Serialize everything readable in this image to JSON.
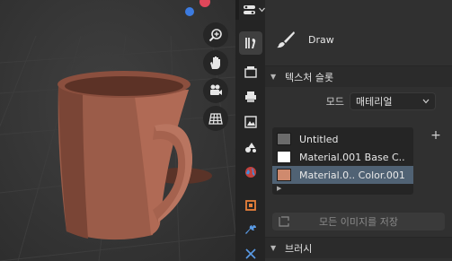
{
  "tool": {
    "name": "Draw",
    "icon": "brush-icon"
  },
  "texture_slots": {
    "title": "텍스처 슬롯",
    "mode_label": "모드",
    "mode_value": "매테리얼",
    "slots": [
      {
        "label": "Untitled",
        "color": "#6b6b6b"
      },
      {
        "label": "Material.001 Base C..",
        "color": "#ffffff"
      },
      {
        "label": "Material.0.. Color.001",
        "color": "#cf8a6e",
        "active": true
      }
    ],
    "add_label": "+",
    "save_button": "모든 이미지를 저장"
  },
  "brush_panel": {
    "title": "브러시"
  },
  "colors": {
    "mug": "#a0604d",
    "accent_blue": "#3c7be0",
    "accent_red": "#e0475a",
    "active_slot": "#506274"
  }
}
